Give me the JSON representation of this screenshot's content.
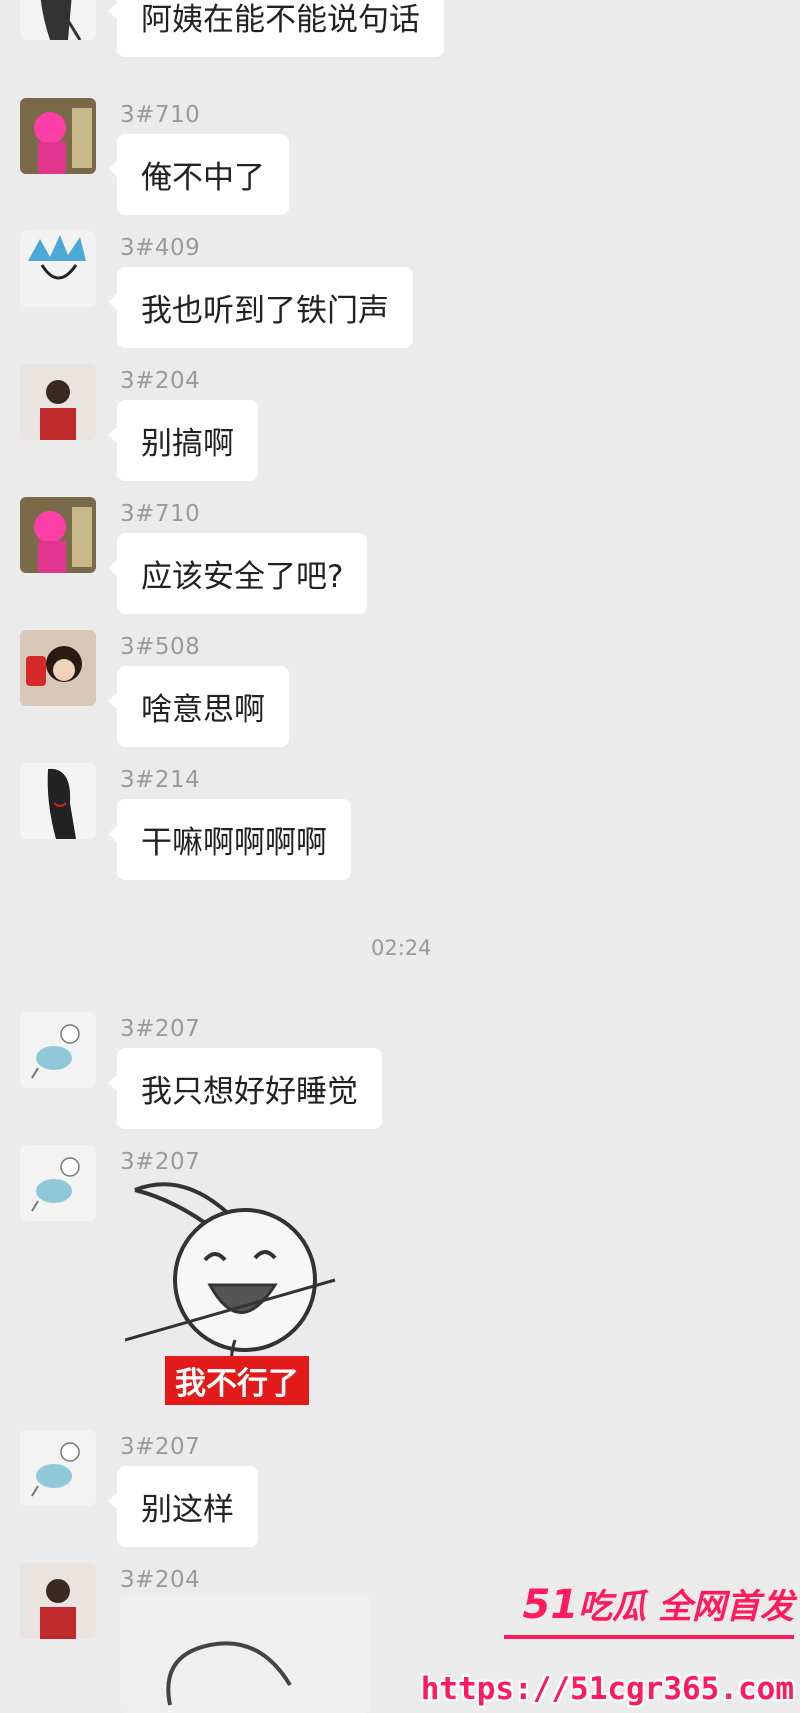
{
  "chat": {
    "top_message": "阿姨在能不能说句话",
    "messages": [
      {
        "sender": "3#710",
        "text": "俺不中了"
      },
      {
        "sender": "3#409",
        "text": "我也听到了铁门声"
      },
      {
        "sender": "3#204",
        "text": "别搞啊"
      },
      {
        "sender": "3#710",
        "text": "应该安全了吧?"
      },
      {
        "sender": "3#508",
        "text": "啥意思啊"
      },
      {
        "sender": "3#214",
        "text": "干嘛啊啊啊啊"
      },
      {
        "sender": "3#207",
        "text": "我只想好好睡觉"
      },
      {
        "sender": "3#207",
        "sticker_caption": "我不行了"
      },
      {
        "sender": "3#207",
        "text": "别这样"
      },
      {
        "sender": "3#204"
      }
    ],
    "timestamp": "02:24"
  },
  "watermark": {
    "logo_number": "51",
    "logo_text": "吃瓜 全网首发",
    "url": "https://51cgr365.com"
  },
  "colors": {
    "background": "#ebebeb",
    "bubble": "#ffffff",
    "sticker_caption_bg": "#e31a1a",
    "watermark": "#ff1a5c"
  }
}
